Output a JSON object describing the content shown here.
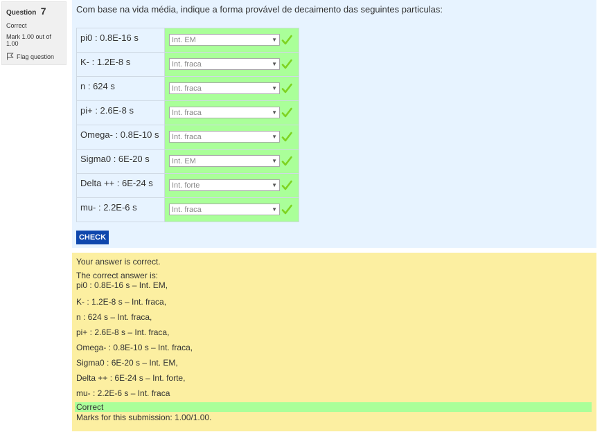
{
  "info": {
    "question_label": "Question",
    "question_number": "7",
    "state": "Correct",
    "grade": "Mark 1.00 out of 1.00",
    "flag_label": "Flag question"
  },
  "question": {
    "text": "Com base na vida média, indique a forma provável de decaimento das seguintes particulas:",
    "rows": [
      {
        "label": "pi0 : 0.8E-16 s",
        "selected": "Int. EM"
      },
      {
        "label": "K- : 1.2E-8 s",
        "selected": "Int. fraca"
      },
      {
        "label": "n : 624 s",
        "selected": "Int. fraca"
      },
      {
        "label": "pi+ : 2.6E-8 s",
        "selected": "Int. fraca"
      },
      {
        "label": "Omega- : 0.8E-10 s",
        "selected": "Int. fraca"
      },
      {
        "label": "Sigma0 : 6E-20 s",
        "selected": "Int. EM"
      },
      {
        "label": "Delta ++ : 6E-24 s",
        "selected": "Int. forte"
      },
      {
        "label": "mu- : 2.2E-6 s",
        "selected": "Int. fraca"
      }
    ],
    "check_label": "CHECK"
  },
  "outcome": {
    "feedback": "Your answer is correct.",
    "right_answer_title": "The correct answer is:",
    "right_answer_lines": [
      "pi0 : 0.8E-16 s – Int. EM,",
      "K- : 1.2E-8 s – Int. fraca,",
      "n : 624 s – Int. fraca,",
      "pi+ : 2.6E-8 s – Int. fraca,",
      "Omega- : 0.8E-10 s – Int. fraca,",
      "Sigma0 : 6E-20 s – Int. EM,",
      "Delta ++ : 6E-24 s – Int. forte,",
      "mu- : 2.2E-6 s – Int. fraca"
    ],
    "correct_label": "Correct",
    "marks": "Marks for this submission: 1.00/1.00."
  },
  "colors": {
    "formulation_bg": "#e7f3ff",
    "outcome_bg": "#fcefa1",
    "correct_bg": "#aaff99",
    "check_button": "#0f47ad",
    "checkmark": "#7ed321"
  },
  "icons": {
    "flag": "flag-icon",
    "correct": "checkmark-icon",
    "dropdown": "chevron-down-icon"
  }
}
